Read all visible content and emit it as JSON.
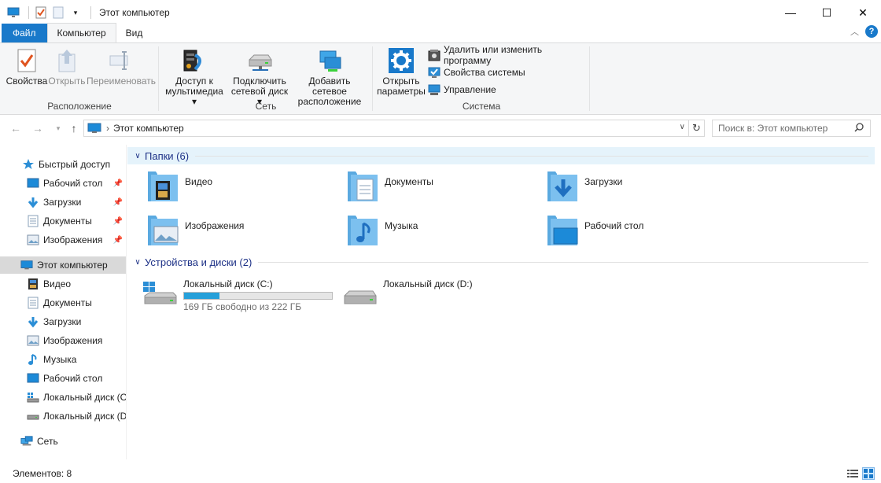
{
  "window": {
    "title": "Этот компьютер",
    "controls": {
      "minimize": "—",
      "maximize": "☐",
      "close": "✕"
    }
  },
  "ribbon_tabs": [
    {
      "label": "Файл"
    },
    {
      "label": "Компьютер"
    },
    {
      "label": "Вид"
    }
  ],
  "ribbon": {
    "groups": {
      "location": "Расположение",
      "network": "Сеть",
      "system": "Система"
    },
    "buttons": {
      "properties": "Свойства",
      "open": "Открыть",
      "rename": "Переименовать",
      "media_access_1": "Доступ к",
      "media_access_2": "мультимедиа ▾",
      "map_drive_1": "Подключить",
      "map_drive_2": "сетевой диск ▾",
      "add_location_1": "Добавить сетевое",
      "add_location_2": "расположение",
      "open_settings_1": "Открыть",
      "open_settings_2": "параметры",
      "uninstall": "Удалить или изменить программу",
      "system_props": "Свойства системы",
      "manage": "Управление"
    }
  },
  "address": {
    "path": "Этот компьютер",
    "separator": "›",
    "search_placeholder": "Поиск в: Этот компьютер"
  },
  "nav_pane": {
    "quick_access": "Быстрый доступ",
    "quick_items": [
      {
        "label": "Рабочий стол",
        "icon": "desktop-icon"
      },
      {
        "label": "Загрузки",
        "icon": "downloads-icon"
      },
      {
        "label": "Документы",
        "icon": "documents-icon"
      },
      {
        "label": "Изображения",
        "icon": "pictures-icon"
      }
    ],
    "this_pc": "Этот компьютер",
    "pc_items": [
      {
        "label": "Видео",
        "icon": "video-icon"
      },
      {
        "label": "Документы",
        "icon": "documents-icon"
      },
      {
        "label": "Загрузки",
        "icon": "downloads-icon"
      },
      {
        "label": "Изображения",
        "icon": "pictures-icon"
      },
      {
        "label": "Музыка",
        "icon": "music-icon"
      },
      {
        "label": "Рабочий стол",
        "icon": "desktop-icon"
      },
      {
        "label": "Локальный диск (C:)",
        "icon": "drive-c-icon"
      },
      {
        "label": "Локальный диск (D:)",
        "icon": "drive-icon"
      }
    ],
    "network": "Сеть"
  },
  "content": {
    "folders_header": "Папки (6)",
    "folders": [
      {
        "label": "Видео",
        "icon": "video-folder-icon"
      },
      {
        "label": "Документы",
        "icon": "documents-folder-icon"
      },
      {
        "label": "Загрузки",
        "icon": "downloads-folder-icon"
      },
      {
        "label": "Изображения",
        "icon": "pictures-folder-icon"
      },
      {
        "label": "Музыка",
        "icon": "music-folder-icon"
      },
      {
        "label": "Рабочий стол",
        "icon": "desktop-folder-icon"
      }
    ],
    "drives_header": "Устройства и диски (2)",
    "drives": [
      {
        "label": "Локальный диск (C:)",
        "free_text": "169 ГБ свободно из 222 ГБ",
        "used_fraction": 0.24
      },
      {
        "label": "Локальный диск (D:)"
      }
    ]
  },
  "status": {
    "items_count": "Элементов: 8"
  },
  "colors": {
    "accent": "#1979ca",
    "folder": "#7cc0ef",
    "folder_dark": "#5aa9e0",
    "progress": "#26a0da",
    "selection": "#d9d9d9",
    "section_header_bg": "#e5f3fb",
    "section_header_text": "#1e3287"
  }
}
